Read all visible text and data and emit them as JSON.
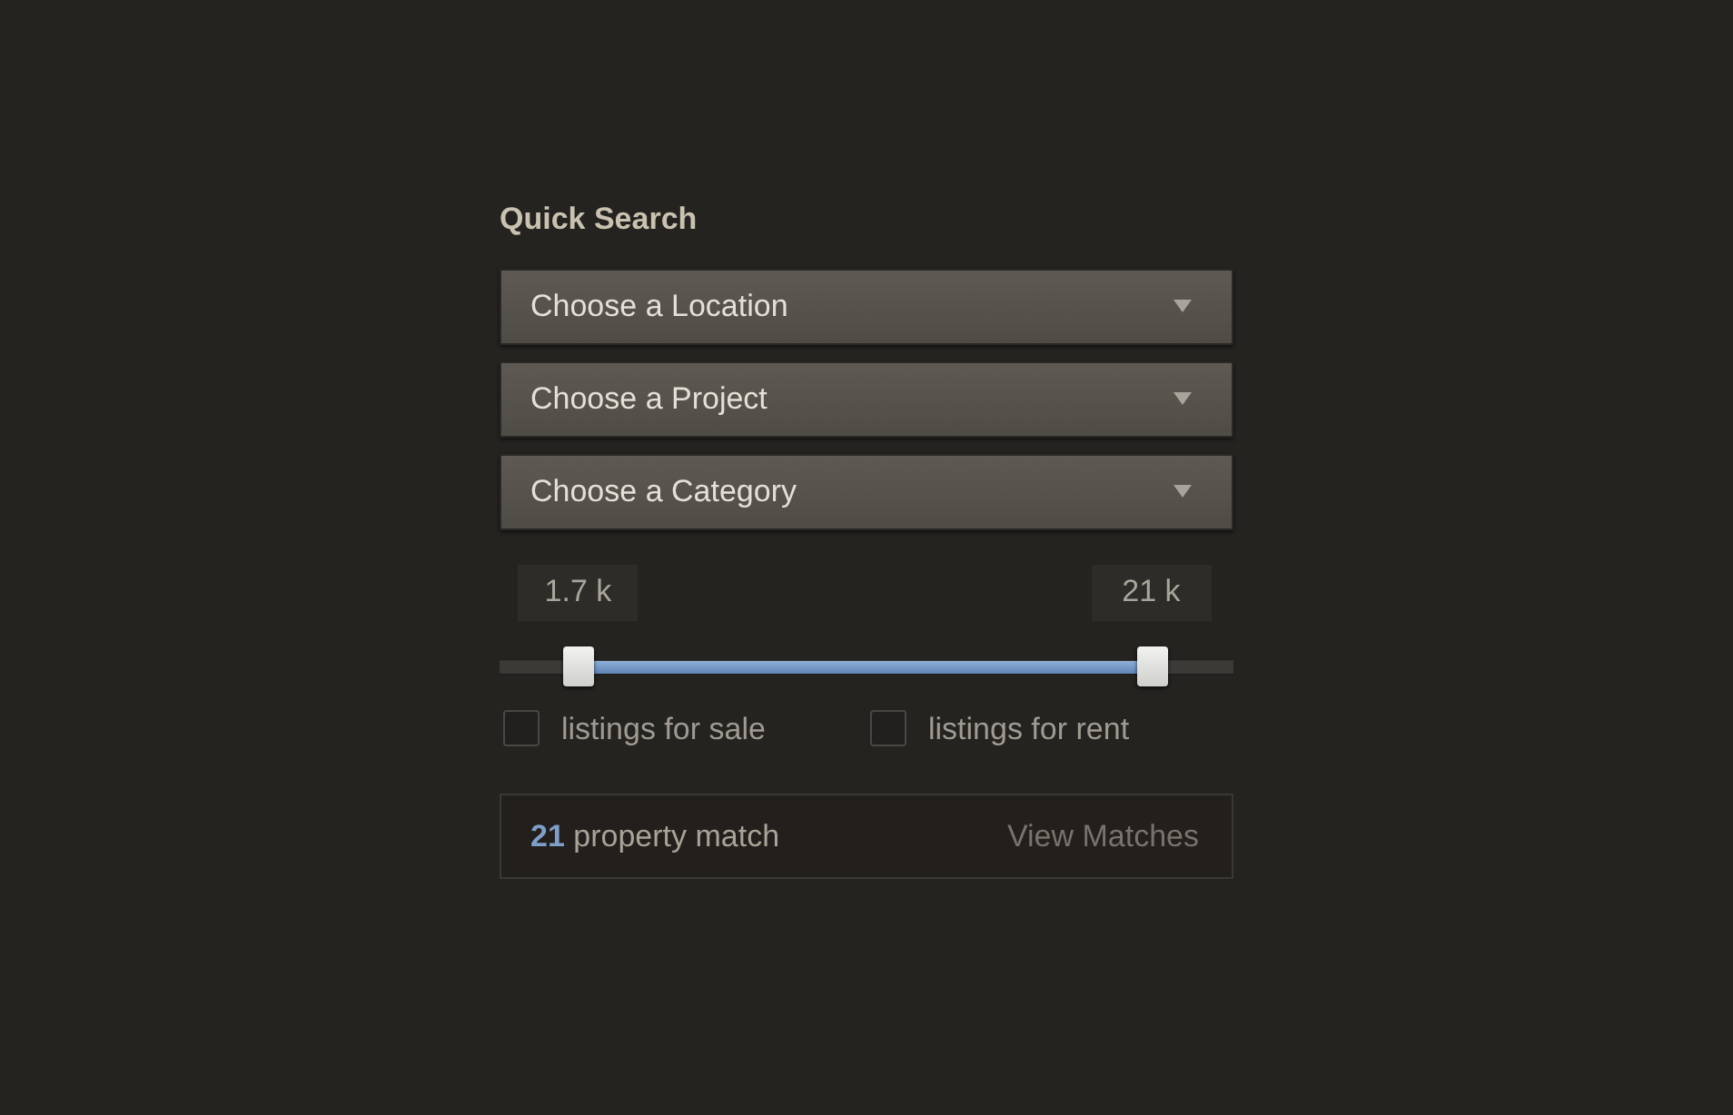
{
  "title": "Quick Search",
  "selects": [
    {
      "placeholder": "Choose a Location"
    },
    {
      "placeholder": "Choose a Project"
    },
    {
      "placeholder": "Choose a Category"
    }
  ],
  "range": {
    "thumbs": [
      {
        "level": 0.107,
        "reading": "1.7 k"
      },
      {
        "level": 0.888,
        "reading": "21 k"
      }
    ]
  },
  "filters": [
    {
      "label": "listings for sale",
      "checked": false
    },
    {
      "label": "listings for rent",
      "checked": false
    }
  ],
  "result": {
    "count": "21",
    "label": "property match",
    "action": "View Matches"
  }
}
